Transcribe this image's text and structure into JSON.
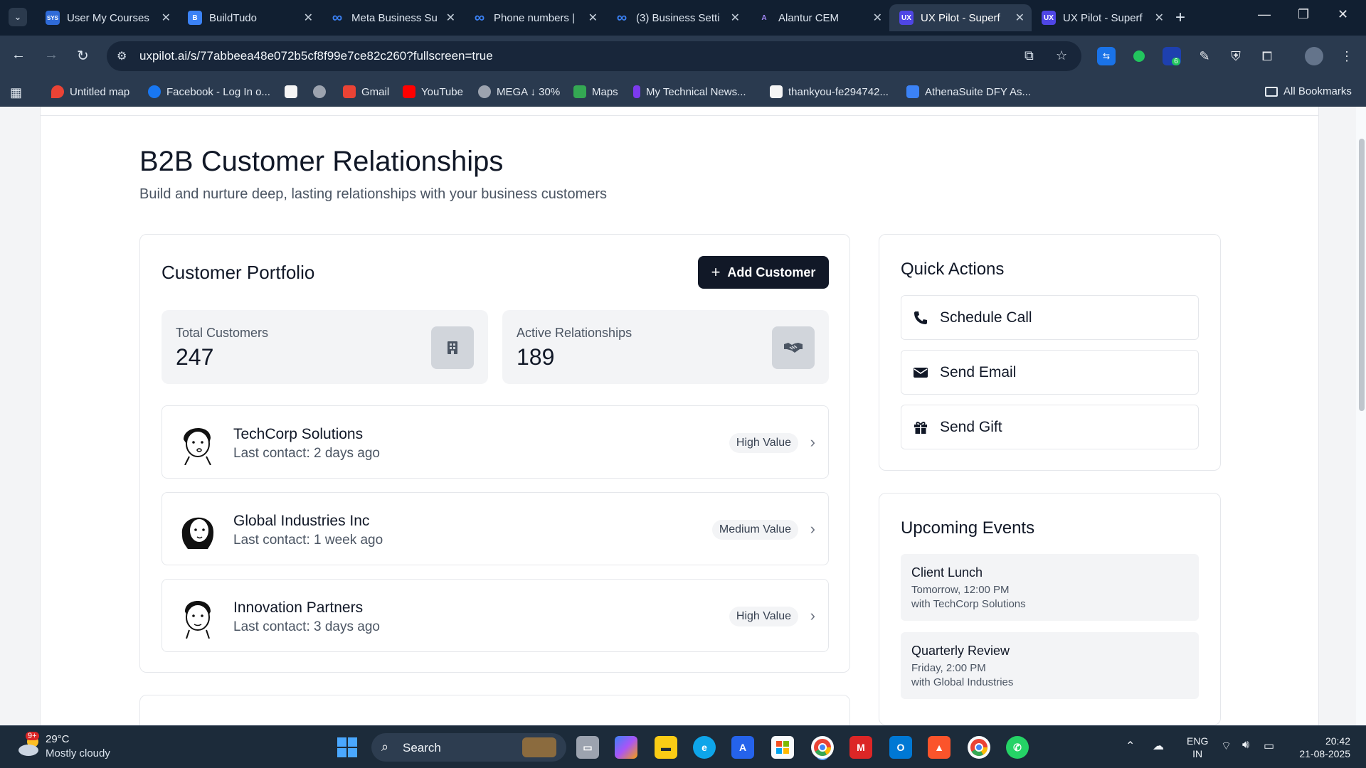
{
  "browser": {
    "tabs": [
      {
        "label": "User My Courses",
        "favicon": "SYS",
        "color": "#2f6bd8"
      },
      {
        "label": "BuildTudo",
        "favicon": "B",
        "color": "#3b82f6"
      },
      {
        "label": "Meta Business Su",
        "favicon": "∞",
        "color": "#0668e1"
      },
      {
        "label": "Phone numbers |",
        "favicon": "∞",
        "color": "#0668e1"
      },
      {
        "label": "(3) Business Setti",
        "favicon": "∞",
        "color": "#0668e1"
      },
      {
        "label": "Alantur CEM",
        "favicon": "A",
        "color": "#6d28d9"
      },
      {
        "label": "UX Pilot - Superf",
        "favicon": "UX",
        "color": "#4f46e5",
        "active": true
      },
      {
        "label": "UX Pilot - Superf",
        "favicon": "UX",
        "color": "#4f46e5"
      }
    ],
    "url": "uxpilot.ai/s/77abbeea48e072b5cf8f99e7ce82c260?fullscreen=true",
    "bookmarks": [
      {
        "label": "Untitled map",
        "color": "#ea4335"
      },
      {
        "label": "Facebook - Log In o...",
        "color": "#1877f2"
      },
      {
        "label": "",
        "color": "#f5f5f5"
      },
      {
        "label": "",
        "color": "#9ca3af"
      },
      {
        "label": "Gmail",
        "color": "#ea4335"
      },
      {
        "label": "YouTube",
        "color": "#ff0000"
      },
      {
        "label": "MEGA ↓ 30%",
        "color": "#9ca3af"
      },
      {
        "label": "Maps",
        "color": "#34a853"
      },
      {
        "label": "My Technical News...",
        "color": "#7c3aed"
      },
      {
        "label": "thankyou-fe294742...",
        "color": "#f5f5f5"
      },
      {
        "label": "AthenaSuite DFY As...",
        "color": "#3b82f6"
      }
    ],
    "all_bookmarks": "All Bookmarks",
    "extension_badge": "6"
  },
  "page": {
    "title": "B2B Customer Relationships",
    "subtitle": "Build and nurture deep, lasting relationships with your business customers"
  },
  "portfolio": {
    "title": "Customer Portfolio",
    "add_button": "Add Customer",
    "stats": [
      {
        "label": "Total Customers",
        "value": "247",
        "icon": "building-icon"
      },
      {
        "label": "Active Relationships",
        "value": "189",
        "icon": "handshake-icon"
      }
    ],
    "customers": [
      {
        "name": "TechCorp Solutions",
        "last_contact": "Last contact: 2 days ago",
        "badge": "High Value"
      },
      {
        "name": "Global Industries Inc",
        "last_contact": "Last contact: 1 week ago",
        "badge": "Medium Value"
      },
      {
        "name": "Innovation Partners",
        "last_contact": "Last contact: 3 days ago",
        "badge": "High Value"
      }
    ]
  },
  "quick_actions": {
    "title": "Quick Actions",
    "items": [
      {
        "label": "Schedule Call",
        "icon": "phone-icon"
      },
      {
        "label": "Send Email",
        "icon": "envelope-icon"
      },
      {
        "label": "Send Gift",
        "icon": "gift-icon"
      }
    ]
  },
  "upcoming_events": {
    "title": "Upcoming Events",
    "items": [
      {
        "title": "Client Lunch",
        "date": "Tomorrow, 12:00 PM",
        "with": "with TechCorp Solutions"
      },
      {
        "title": "Quarterly Review",
        "date": "Friday, 2:00 PM",
        "with": "with Global Industries"
      }
    ]
  },
  "taskbar": {
    "temperature": "29°C",
    "weather": "Mostly cloudy",
    "weather_badge": "9+",
    "search": "Search",
    "language": "ENG",
    "region": "IN",
    "time": "20:42",
    "date": "21-08-2025"
  }
}
